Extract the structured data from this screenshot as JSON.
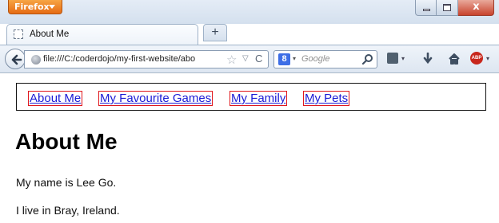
{
  "window": {
    "app_button": "Firefox",
    "controls": {
      "close_label": "x"
    }
  },
  "tab": {
    "title": "About Me"
  },
  "new_tab_label": "+",
  "toolbar": {
    "url": "file:///C:/coderdojo/my-first-website/abo",
    "search_placeholder": "Google",
    "search_engine_icon": "google-g-icon",
    "search_engine_letter": "8",
    "adblock_label": "ABP"
  },
  "page": {
    "nav_links": [
      "About Me",
      "My Favourite Games",
      "My Family",
      "My Pets"
    ],
    "heading": "About Me",
    "paragraphs": [
      "My name is Lee Go.",
      "I live in Bray, Ireland."
    ]
  },
  "colors": {
    "link": "#1b1bd6",
    "link_outline": "#e0171d",
    "firefox_button": "#e66b14"
  }
}
